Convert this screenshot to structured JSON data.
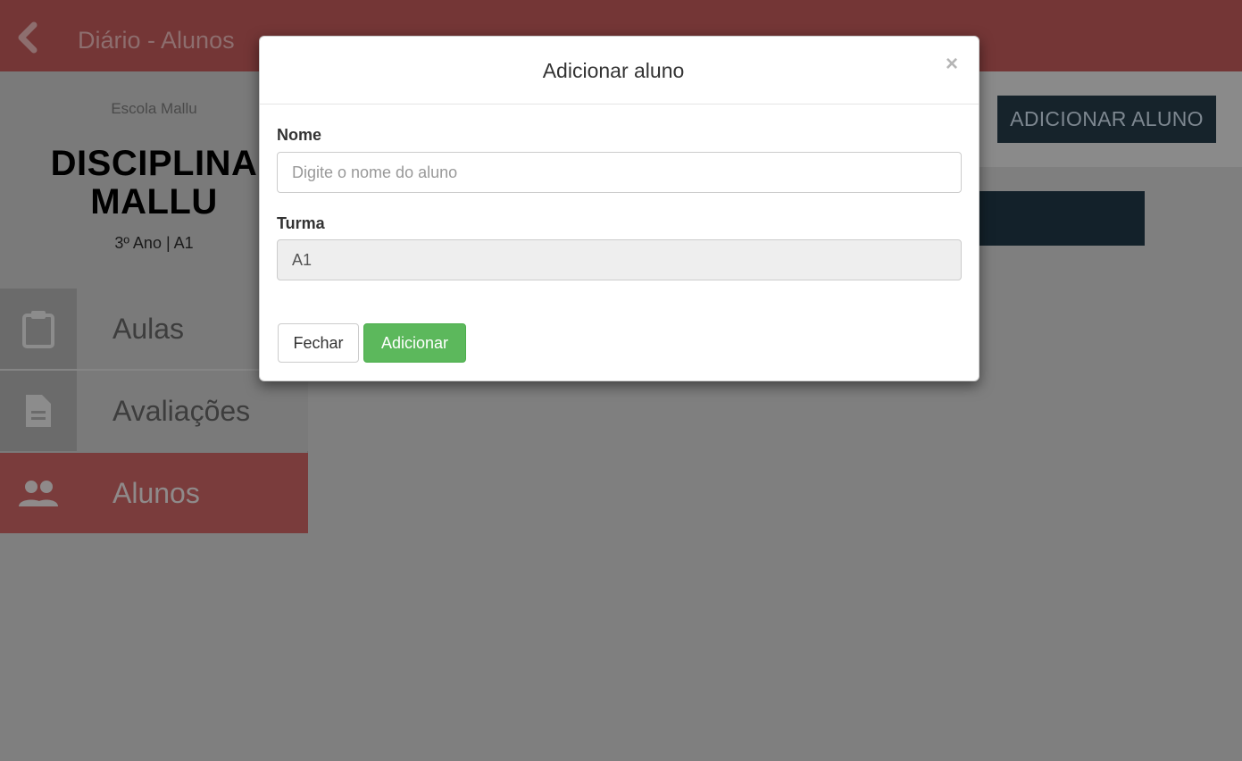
{
  "topbar": {
    "title": "Diário - Alunos",
    "back_icon": "chevron-left-icon"
  },
  "sidebar": {
    "school": "Escola Mallu",
    "discipline_line1": "DISCIPLINA",
    "discipline_line2": "MALLU",
    "grade": "3º Ano | A1",
    "items": [
      {
        "label": "Aulas",
        "icon": "clipboard-icon",
        "active": false
      },
      {
        "label": "Avaliações",
        "icon": "document-icon",
        "active": false
      },
      {
        "label": "Alunos",
        "icon": "people-icon",
        "active": true
      }
    ]
  },
  "main": {
    "add_button_label": "ADICIONAR ALUNO"
  },
  "modal": {
    "title": "Adicionar aluno",
    "close_symbol": "×",
    "name_label": "Nome",
    "name_placeholder": "Digite o nome do aluno",
    "name_value": "",
    "class_label": "Turma",
    "class_value": "A1",
    "close_button_label": "Fechar",
    "add_button_label": "Adicionar"
  },
  "colors": {
    "brand_red": "#c0504d",
    "dark_navy": "#1e3a48",
    "success_green": "#5cb85c"
  }
}
